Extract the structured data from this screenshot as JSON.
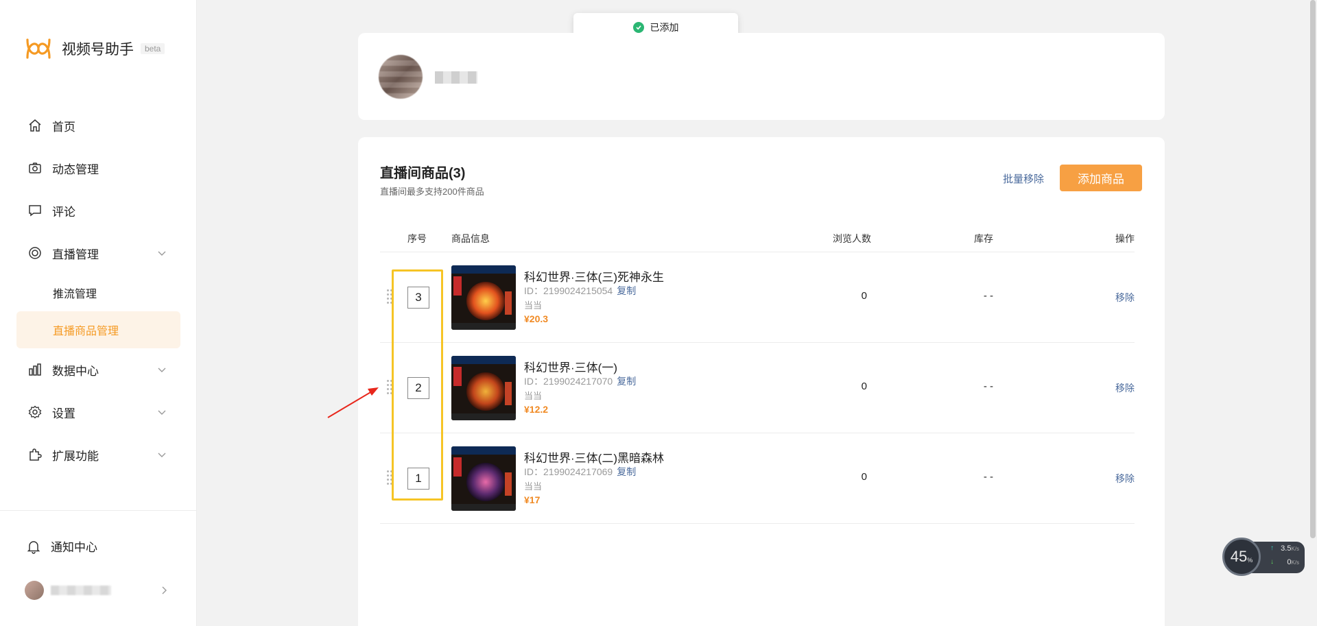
{
  "app": {
    "name": "视频号助手",
    "badge": "beta"
  },
  "toast": {
    "text": "已添加"
  },
  "nav": {
    "items": [
      {
        "label": "首页"
      },
      {
        "label": "动态管理"
      },
      {
        "label": "评论"
      },
      {
        "label": "直播管理"
      },
      {
        "label": "数据中心"
      },
      {
        "label": "设置"
      },
      {
        "label": "扩展功能"
      }
    ],
    "sub_items": [
      {
        "label": "推流管理"
      },
      {
        "label": "直播商品管理"
      }
    ],
    "notice": "通知中心"
  },
  "products_section": {
    "title": "直播间商品(3)",
    "subtitle": "直播间最多支持200件商品",
    "batch_remove": "批量移除",
    "add_button": "添加商品",
    "columns": {
      "seq": "序号",
      "info": "商品信息",
      "views": "浏览人数",
      "stock": "库存",
      "action": "操作"
    },
    "rows": [
      {
        "seq": "3",
        "name": "科幻世界·三体(三)死神永生",
        "id_label": "ID：",
        "id": "2199024215054",
        "copy": "复制",
        "shop": "当当",
        "price": "¥20.3",
        "views": "0",
        "stock": "- -",
        "action": "移除"
      },
      {
        "seq": "2",
        "name": "科幻世界·三体(一)",
        "id_label": "ID：",
        "id": "2199024217070",
        "copy": "复制",
        "shop": "当当",
        "price": "¥12.2",
        "views": "0",
        "stock": "- -",
        "action": "移除"
      },
      {
        "seq": "1",
        "name": "科幻世界·三体(二)黑暗森林",
        "id_label": "ID：",
        "id": "2199024217069",
        "copy": "复制",
        "shop": "当当",
        "price": "¥17",
        "views": "0",
        "stock": "- -",
        "action": "移除"
      }
    ]
  },
  "speed_widget": {
    "percent": "45",
    "percent_unit": "%",
    "up": "3.5",
    "down": "0",
    "unit": "K/s"
  },
  "colors": {
    "accent": "#f7a043",
    "active_bg": "#fdf3e7",
    "link": "#4a6a9c",
    "price": "#f08a24",
    "highlight": "#f6c425"
  }
}
